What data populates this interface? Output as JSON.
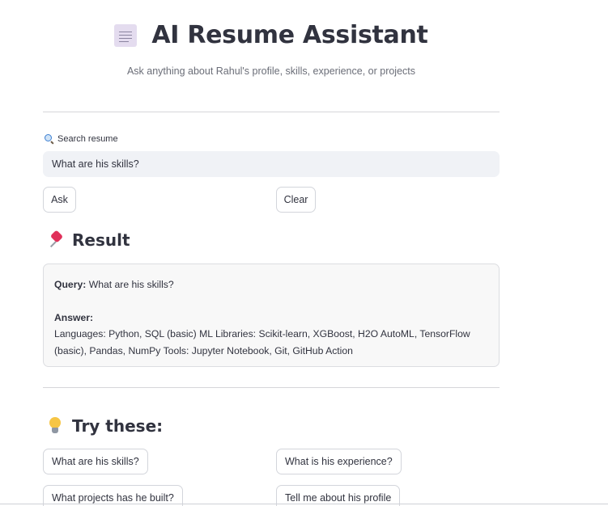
{
  "header": {
    "title": "AI Resume Assistant",
    "subtitle": "Ask anything about Rahul's profile, skills, experience, or projects",
    "icon": "page-facing-up-icon"
  },
  "search": {
    "label": "Search resume",
    "icon": "magnifying-glass-icon",
    "value": "What are his skills?"
  },
  "actions": {
    "ask_label": "Ask",
    "clear_label": "Clear"
  },
  "result": {
    "heading": "Result",
    "icon": "pushpin-icon",
    "query_label": "Query:",
    "query_value": "What are his skills?",
    "answer_label": "Answer:",
    "answer_text": "Languages: Python, SQL (basic) ML Libraries: Scikit-learn, XGBoost, H2O AutoML, TensorFlow (basic), Pandas, NumPy Tools: Jupyter Notebook, Git, GitHub Action"
  },
  "suggestions": {
    "heading": "Try these:",
    "icon": "light-bulb-icon",
    "items": [
      "What are his skills?",
      "What is his experience?",
      "What projects has he built?",
      "Tell me about his profile"
    ]
  },
  "colors": {
    "text": "#31333f",
    "muted": "#6b6e78",
    "input_bg": "#f0f2f6",
    "result_bg": "#f8f8f8",
    "border": "#d3d5db"
  }
}
